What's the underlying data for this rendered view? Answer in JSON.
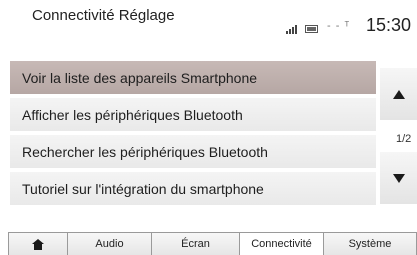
{
  "header": {
    "title": "Connectivité Réglage",
    "network_indicator": "- - ᵀ",
    "clock": "15:30",
    "icons": [
      "signal-strength-icon",
      "battery-icon"
    ]
  },
  "menu": {
    "items": [
      {
        "label": "Voir la liste des appareils Smartphone",
        "selected": true
      },
      {
        "label": "Afficher les périphériques Bluetooth",
        "selected": false
      },
      {
        "label": "Rechercher les périphériques Bluetooth",
        "selected": false
      },
      {
        "label": "Tutoriel sur l'intégration du smartphone",
        "selected": false
      }
    ]
  },
  "scroll": {
    "page_indicator": "1/2",
    "up_icon": "arrow-up-icon",
    "down_icon": "arrow-down-icon"
  },
  "tabs": {
    "home_icon": "home-icon",
    "items": [
      {
        "label": "Audio"
      },
      {
        "label": "Écran"
      },
      {
        "label": "Connectivité",
        "active": true
      },
      {
        "label": "Système"
      }
    ]
  },
  "colors": {
    "selected_row": "#bcaeab",
    "row": "#eeeeee",
    "background": "#ffffff"
  }
}
